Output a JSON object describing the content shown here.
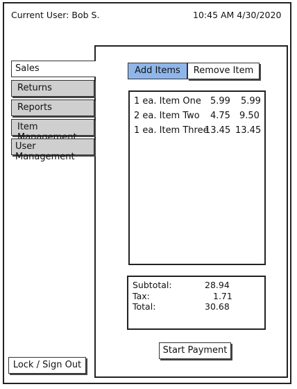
{
  "header": {
    "current_user": "Current User:  Bob S.",
    "datetime": "10:45 AM 4/30/2020"
  },
  "sidebar": {
    "items": [
      {
        "label": "Sales",
        "active": true
      },
      {
        "label": "Returns",
        "active": false
      },
      {
        "label": "Reports",
        "active": false
      },
      {
        "label": "Item Management",
        "active": false
      },
      {
        "label": "User Management",
        "active": false
      }
    ],
    "lock_label": "Lock / Sign Out"
  },
  "tabs": {
    "add_label": "Add Items",
    "remove_label": "Remove Item"
  },
  "items": [
    {
      "desc": "1 ea. Item One",
      "price": "5.99",
      "total": "5.99"
    },
    {
      "desc": "2 ea. Item Two",
      "price": "4.75",
      "total": "9.50"
    },
    {
      "desc": "1 ea. Item Three",
      "price": "13.45",
      "total": "13.45"
    }
  ],
  "totals": {
    "subtotal_label": "Subtotal:",
    "subtotal_value": "28.94",
    "tax_label": "Tax:",
    "tax_value": "1.71",
    "total_label": "Total:",
    "total_value": "30.68"
  },
  "actions": {
    "start_payment_label": "Start Payment"
  },
  "colors": {
    "active_tab": "#8fb6ea",
    "nav_inactive": "#cfcfcf"
  }
}
